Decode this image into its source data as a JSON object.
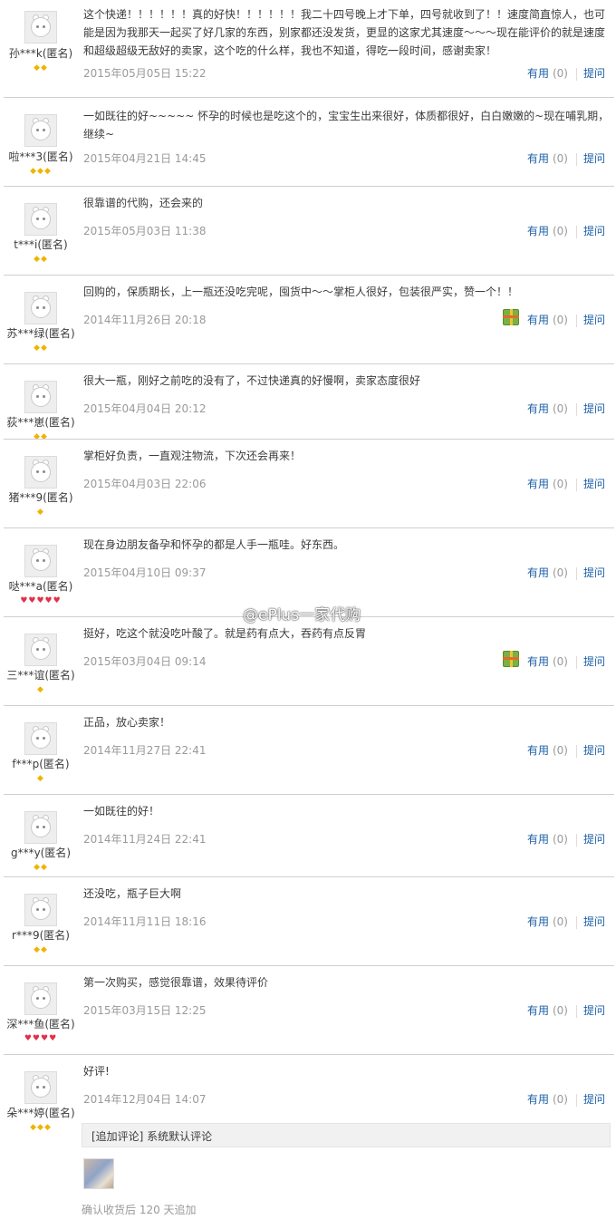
{
  "reviews": [
    {
      "user": "孙***k(匿名)",
      "rank_type": "diamond",
      "rank": "◆◆",
      "content": "这个快递！！！！！！真的好快！！！！！！我二十四号晚上才下单，四号就收到了！！速度简直惊人，也可能是因为我那天一起买了好几家的东西，别家都还没发货，更显的这家尤其速度～～～现在能评价的就是速度和超级超级无敌好的卖家，这个吃的什么样，我也不知道，得吃一段时间，感谢卖家！",
      "date": "2015年05月05日 15:22",
      "useful": "有用",
      "count": "(0)",
      "ask": "提问",
      "gift": false
    },
    {
      "user": "啦***3(匿名)",
      "rank_type": "diamond",
      "rank": "◆◆◆",
      "content": "一如既往的好~~~~~ 怀孕的时候也是吃这个的，宝宝生出来很好，体质都很好，白白嫩嫩的~现在哺乳期，继续~",
      "date": "2015年04月21日 14:45",
      "useful": "有用",
      "count": "(0)",
      "ask": "提问",
      "gift": false
    },
    {
      "user": "t***i(匿名)",
      "rank_type": "diamond",
      "rank": "◆◆",
      "content": "很靠谱的代购，还会来的",
      "date": "2015年05月03日 11:38",
      "useful": "有用",
      "count": "(0)",
      "ask": "提问",
      "gift": false
    },
    {
      "user": "苏***绿(匿名)",
      "rank_type": "diamond",
      "rank": "◆◆",
      "content": "回购的，保质期长，上一瓶还没吃完呢，囤货中～～掌柜人很好，包装很严实，赞一个！！",
      "date": "2014年11月26日 20:18",
      "useful": "有用",
      "count": "(0)",
      "ask": "提问",
      "gift": true
    },
    {
      "user": "荻***崽(匿名)",
      "rank_type": "diamond",
      "rank": "◆◆",
      "content": "很大一瓶，刚好之前吃的没有了，不过快递真的好慢啊，卖家态度很好",
      "date": "2015年04月04日 20:12",
      "useful": "有用",
      "count": "(0)",
      "ask": "提问",
      "gift": false
    },
    {
      "user": "猪***9(匿名)",
      "rank_type": "diamond",
      "rank": "◆",
      "content": "掌柜好负责，一直观注物流，下次还会再来！",
      "date": "2015年04月03日 22:06",
      "useful": "有用",
      "count": "(0)",
      "ask": "提问",
      "gift": false
    },
    {
      "user": "哒***a(匿名)",
      "rank_type": "heart",
      "rank": "♥♥♥♥♥",
      "content": "现在身边朋友备孕和怀孕的都是人手一瓶哇。好东西。",
      "date": "2015年04月10日 09:37",
      "useful": "有用",
      "count": "(0)",
      "ask": "提问",
      "gift": false
    },
    {
      "user": "三***谊(匿名)",
      "rank_type": "diamond",
      "rank": "◆",
      "content": "挺好，吃这个就没吃叶酸了。就是药有点大，吞药有点反胃",
      "date": "2015年03月04日 09:14",
      "useful": "有用",
      "count": "(0)",
      "ask": "提问",
      "gift": true
    },
    {
      "user": "f***p(匿名)",
      "rank_type": "diamond",
      "rank": "◆",
      "content": "正品，放心卖家！",
      "date": "2014年11月27日 22:41",
      "useful": "有用",
      "count": "(0)",
      "ask": "提问",
      "gift": false
    },
    {
      "user": "g***y(匿名)",
      "rank_type": "diamond",
      "rank": "◆◆",
      "content": "一如既往的好！",
      "date": "2014年11月24日 22:41",
      "useful": "有用",
      "count": "(0)",
      "ask": "提问",
      "gift": false
    },
    {
      "user": "r***9(匿名)",
      "rank_type": "diamond",
      "rank": "◆◆",
      "content": "还没吃，瓶子巨大啊",
      "date": "2014年11月11日 18:16",
      "useful": "有用",
      "count": "(0)",
      "ask": "提问",
      "gift": false
    },
    {
      "user": "深***鱼(匿名)",
      "rank_type": "heart",
      "rank": "♥♥♥♥",
      "content": "第一次购买，感觉很靠谱，效果待评价",
      "date": "2015年03月15日 12:25",
      "useful": "有用",
      "count": "(0)",
      "ask": "提问",
      "gift": false
    },
    {
      "user": "朵***婷(匿名)",
      "rank_type": "diamond",
      "rank": "◆◆◆",
      "content": "好评!",
      "date": "2014年12月04日 14:07",
      "useful": "有用",
      "count": "(0)",
      "ask": "提问",
      "gift": false
    }
  ],
  "append": {
    "label": "[追加评论] 系统默认评论",
    "note": "确认收货后 120 天追加"
  },
  "watermark": "@ePlus一家代购"
}
